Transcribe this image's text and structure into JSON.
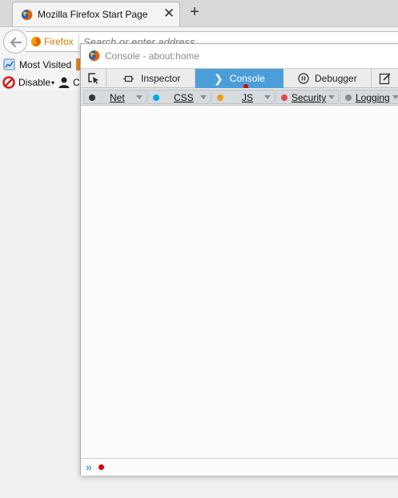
{
  "browser": {
    "tab": {
      "title": "Mozilla Firefox Start Page",
      "close_glyph": "✕",
      "favicon": "firefox-icon"
    },
    "new_tab_glyph": "+",
    "identity_label": "Firefox",
    "url_placeholder": "Search or enter address",
    "bookmarks": {
      "most_visited": "Most Visited",
      "disable": "Disable",
      "disable_caret": "▾",
      "user_cut": "C"
    }
  },
  "devtools": {
    "window_title": "Console - about:home",
    "tabs": [
      {
        "label": "Inspector"
      },
      {
        "label": "Console"
      },
      {
        "label": "Debugger"
      }
    ],
    "console_glyph": "❯",
    "filters": [
      {
        "label": "Net",
        "color": "#333333"
      },
      {
        "label": "CSS",
        "color": "#00a8e8"
      },
      {
        "label": "JS",
        "color": "#f29c15"
      },
      {
        "label": "Security",
        "color": "#e04a4a"
      },
      {
        "label": "Logging",
        "color": "#8a8a8a"
      }
    ],
    "prompt_glyph": "»"
  },
  "colors": {
    "accent": "#4c9ed9",
    "error": "#e00000",
    "identity": "#d77800"
  }
}
